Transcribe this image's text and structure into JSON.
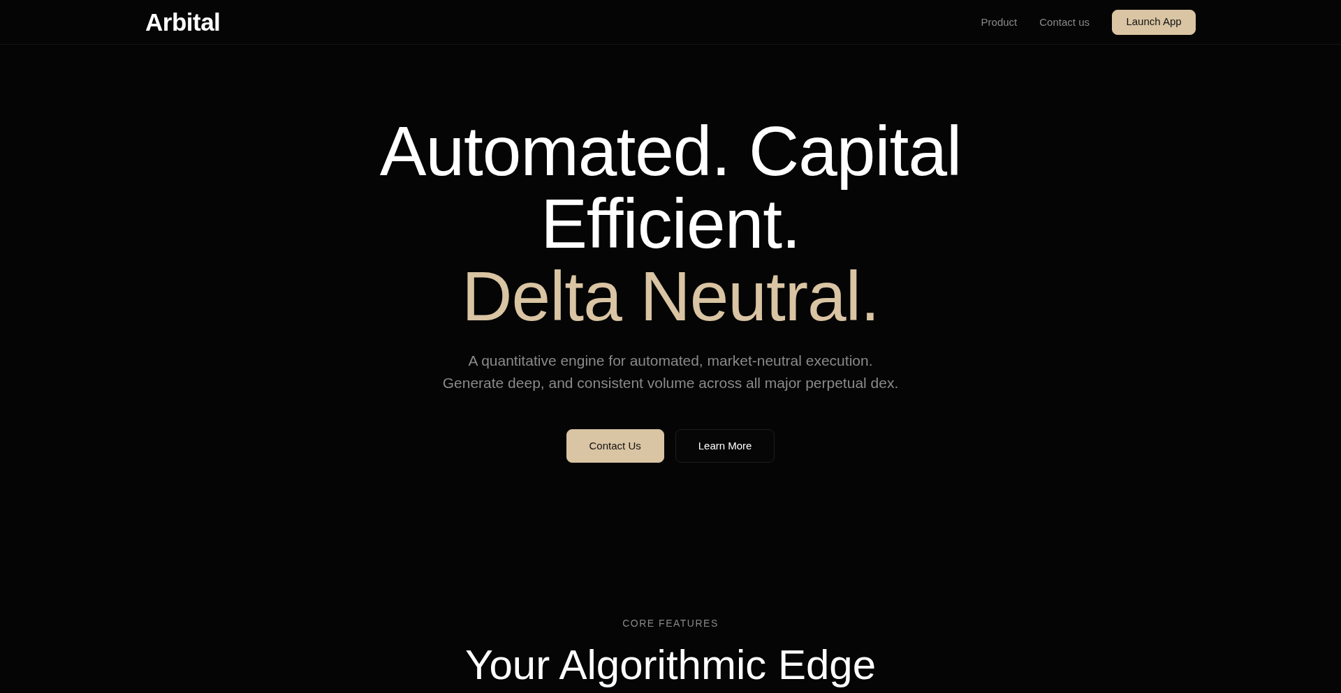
{
  "header": {
    "logo": "Arbital",
    "nav_links": [
      {
        "label": "Product"
      },
      {
        "label": "Contact us"
      }
    ],
    "cta": {
      "label": "Launch App",
      "kind": "primary"
    }
  },
  "hero": {
    "heading": {
      "lines": [
        {
          "text": "Automated. Capital",
          "accent": false
        },
        {
          "text": "Efficient.",
          "accent": false
        },
        {
          "text": "Delta Neutral.",
          "accent": true
        }
      ]
    },
    "subtitle": {
      "lines": [
        "A quantitative engine for automated, market-neutral execution.",
        "Generate deep, and consistent volume across all major perpetual dex."
      ]
    },
    "actions": [
      {
        "label": "Contact Us",
        "kind": "primary"
      },
      {
        "label": "Learn More",
        "kind": "secondary"
      }
    ]
  },
  "features": {
    "eyebrow": "CORE FEATURES",
    "heading": "Your Algorithmic Edge"
  }
}
